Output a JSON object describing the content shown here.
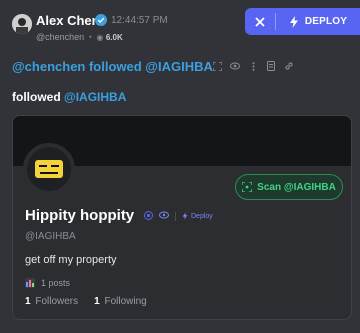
{
  "header": {
    "user_name": "Alex Chen",
    "timestamp": "12:44:57 PM",
    "handle": "@chenchen",
    "followers_count": "6.0K",
    "deploy_label": "DEPLOY"
  },
  "activity": {
    "text": "@chenchen followed @IAGIHBA",
    "icons": [
      "scan-icon",
      "eye-icon",
      "more-icon",
      "document-icon",
      "link-icon"
    ]
  },
  "message": {
    "prefix": "followed",
    "mention": "@IAGIHBA"
  },
  "card": {
    "scan_label": "Scan @IAGIHBA",
    "name": "Hippity hoppity",
    "deploy_label": "Deploy",
    "handle": "@IAGIHBA",
    "bio": "get off my property",
    "posts_label": "1 posts",
    "followers_count": "1",
    "followers_label": "Followers",
    "following_count": "1",
    "following_label": "Following"
  },
  "colors": {
    "background": "#313338",
    "accent": "#5865f2",
    "mention": "#3aa0e0",
    "scan_green": "#3fd38a"
  }
}
